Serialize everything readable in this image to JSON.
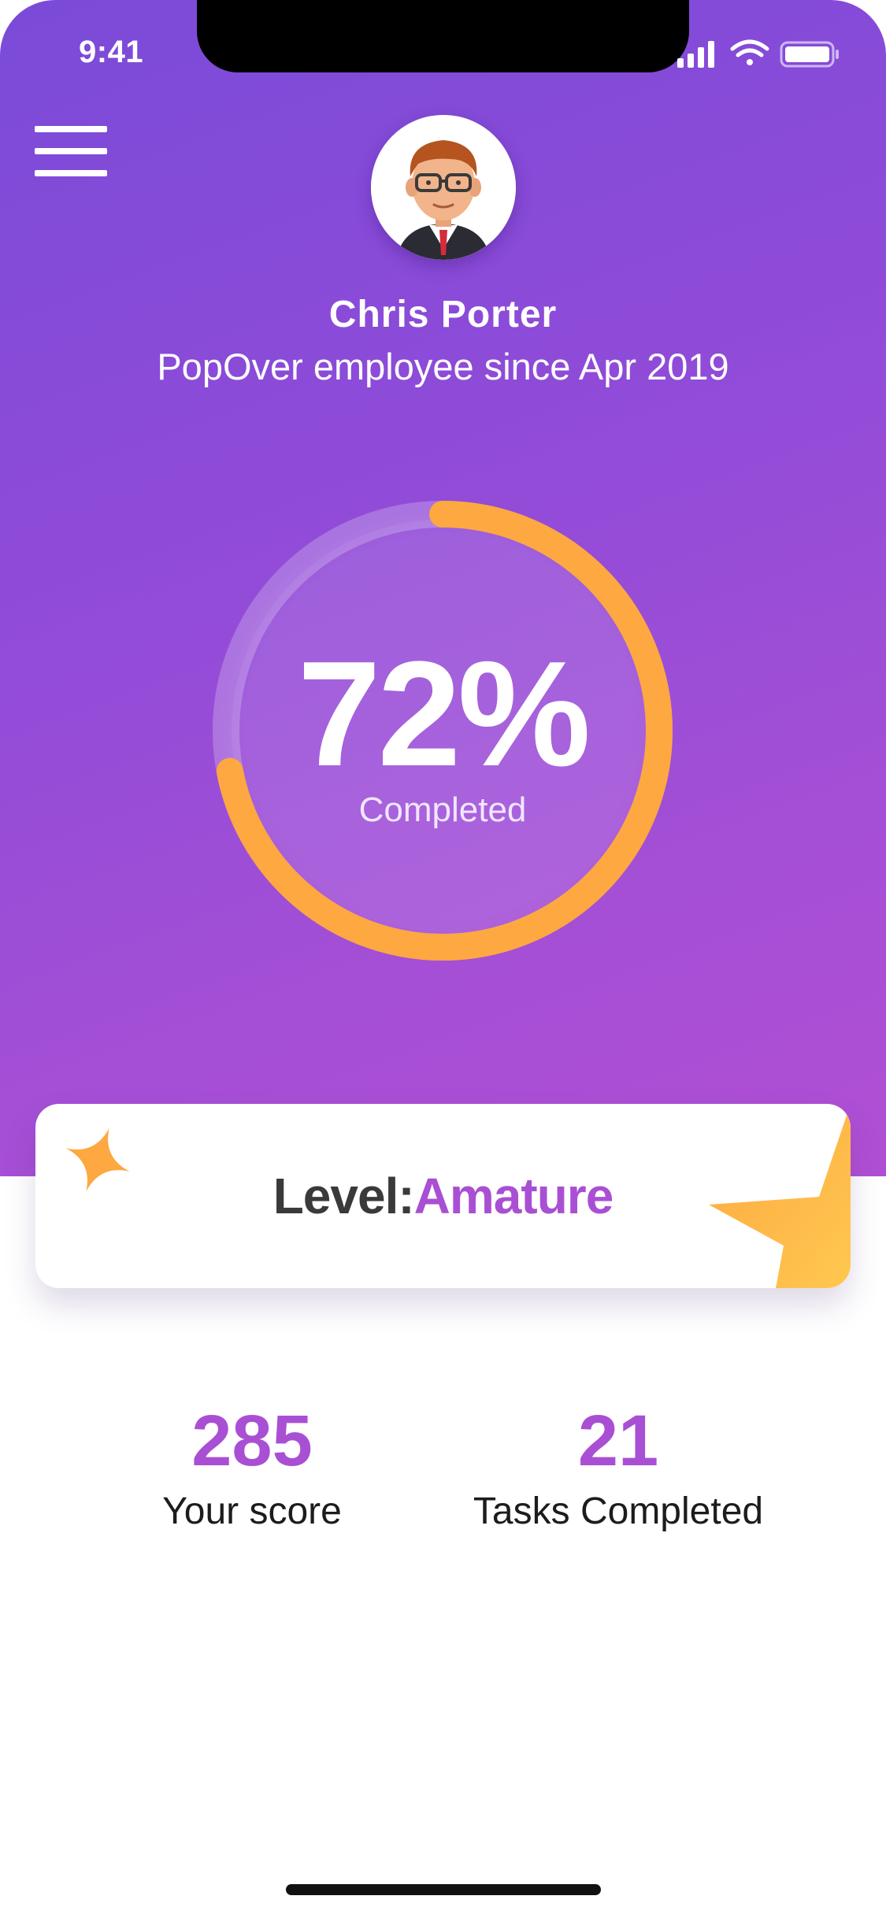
{
  "status_bar": {
    "time": "9:41"
  },
  "profile": {
    "name": "Chris Porter",
    "since": "PopOver employee since Apr 2019"
  },
  "progress": {
    "percent_label": "72%",
    "caption": "Completed",
    "value": 0.72
  },
  "level": {
    "label": "Level:",
    "value": "Amature"
  },
  "stats": [
    {
      "value": "285",
      "label": "Your score"
    },
    {
      "value": "21",
      "label": "Tasks Completed"
    }
  ],
  "colors": {
    "accent": "#a94fd4",
    "ring": "#fda840",
    "gradient_start": "#7a4bd8",
    "gradient_end": "#b14fd4"
  },
  "icons": {
    "menu": "hamburger-menu-icon",
    "signal": "cellular-signal-icon",
    "wifi": "wifi-icon",
    "battery": "battery-icon",
    "sparkle": "sparkle-icon",
    "star": "star-icon"
  }
}
